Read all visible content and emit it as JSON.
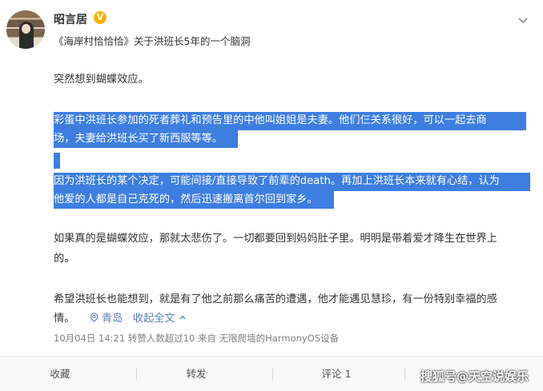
{
  "post": {
    "username": "昭言居",
    "verify_badge": "V",
    "source": "《海岸村恰恰恰》关于洪班长5年的一个脑洞",
    "paragraphs": {
      "p1": "突然想到蝴蝶效应。",
      "p2_line1": "彩蛋中洪班长参加的死者葬礼和预告里的中他叫姐姐是夫妻。他们仨关系很好，可以一起去商",
      "p2_line2": "场，夫妻给洪班长买了新西服等等。",
      "p3_line1": "因为洪班长的某个决定，可能间接/直接导致了前辈的death。再加上洪班长本来就有心结，认为",
      "p3_line2": "他爱的人都是自己克死的，然后迅速搬离首尔回到家乡。",
      "p4_line1": "如果真的是蝴蝶效应，那就太悲伤了。一切都要回到妈妈肚子里。明明是带着爱才降生在世界上",
      "p4_line2": "的。",
      "p5_line1": "希望洪班长也能想到，就是有了他之前那么痛苦的遭遇，他才能遇见慧珍，有一份特别幸福的感",
      "p5_line2": "情。"
    },
    "location": "青岛",
    "expand_label": "收起全文",
    "expand_icon": "chevron-up-icon",
    "footer": "10月04日 14:21 转赞人数超过10  来自 无限爬墙的HarmonyOS设备"
  },
  "actions": {
    "favorite": "收藏",
    "forward": "转发",
    "comment": "评论 1"
  },
  "watermark": "搜狐号@天空说娱乐",
  "colors": {
    "highlight": "#3d7ee0",
    "link": "#5b81b8",
    "verify": "#f7b500"
  }
}
